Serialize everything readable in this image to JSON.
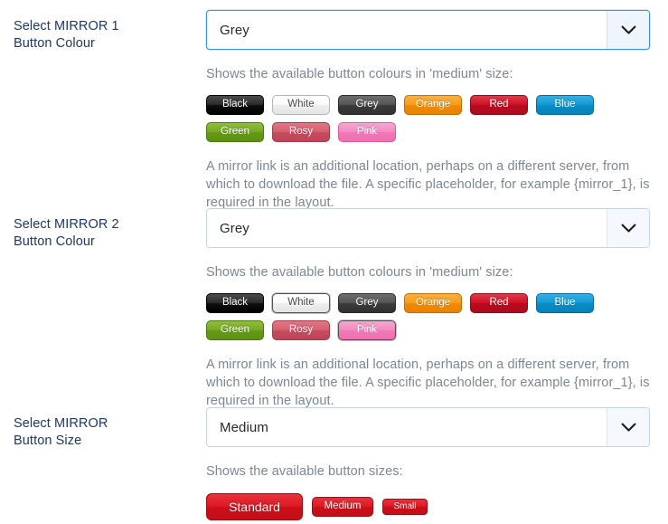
{
  "rows": [
    {
      "label_line1": "Select MIRROR 1",
      "label_line2": "Button Colour",
      "select_value": "Grey",
      "helper_top": "Shows the available button colours in 'medium' size:",
      "helper_bottom": "A mirror link is an additional location, perhaps on a different server, from which to download the file. A specific placeholder, for example {mirror_1}, is required in the layout.",
      "swatches": [
        {
          "label": "Black",
          "key": "black",
          "hex": "#000000",
          "selected": false
        },
        {
          "label": "White",
          "key": "white",
          "hex": "#eeeeee",
          "selected": false
        },
        {
          "label": "Grey",
          "key": "grey",
          "hex": "#3c3c3c",
          "selected": false
        },
        {
          "label": "Orange",
          "key": "orange",
          "hex": "#ef8b05",
          "selected": false
        },
        {
          "label": "Red",
          "key": "red",
          "hex": "#bb0a1f",
          "selected": false
        },
        {
          "label": "Blue",
          "key": "blue",
          "hex": "#0a8cc4",
          "selected": false
        },
        {
          "label": "Green",
          "key": "green",
          "hex": "#659a16",
          "selected": false
        },
        {
          "label": "Rosy",
          "key": "rosy",
          "hex": "#c74b5e",
          "selected": false
        },
        {
          "label": "Pink",
          "key": "pink",
          "hex": "#f078b6",
          "selected": false
        }
      ]
    },
    {
      "label_line1": "Select MIRROR 2",
      "label_line2": "Button Colour",
      "select_value": "Grey",
      "helper_top": "Shows the available button colours in 'medium' size:",
      "helper_bottom": "A mirror link is an additional location, perhaps on a different server, from which to download the file. A specific placeholder, for example {mirror_1}, is required in the layout.",
      "swatches": [
        {
          "label": "Black",
          "key": "black",
          "hex": "#000000",
          "selected": false
        },
        {
          "label": "White",
          "key": "white",
          "hex": "#eeeeee",
          "selected": true
        },
        {
          "label": "Grey",
          "key": "grey",
          "hex": "#3c3c3c",
          "selected": false
        },
        {
          "label": "Orange",
          "key": "orange",
          "hex": "#ef8b05",
          "selected": false
        },
        {
          "label": "Red",
          "key": "red",
          "hex": "#bb0a1f",
          "selected": false
        },
        {
          "label": "Blue",
          "key": "blue",
          "hex": "#0a8cc4",
          "selected": false
        },
        {
          "label": "Green",
          "key": "green",
          "hex": "#659a16",
          "selected": false
        },
        {
          "label": "Rosy",
          "key": "rosy",
          "hex": "#c74b5e",
          "selected": false
        },
        {
          "label": "Pink",
          "key": "pink",
          "hex": "#f078b6",
          "selected": true
        }
      ]
    }
  ],
  "size_row": {
    "label_line1": "Select MIRROR",
    "label_line2": "Button Size",
    "select_value": "Medium",
    "helper_top": "Shows the available button sizes:",
    "sizes": [
      {
        "label": "Standard",
        "key": "standard"
      },
      {
        "label": "Medium",
        "key": "medium"
      },
      {
        "label": "Small",
        "key": "small"
      }
    ],
    "size_button_hex": "#cc0d18"
  },
  "theme": {
    "label_color": "#1f3864",
    "helper_color": "#7b8794",
    "select_focus_border": "#3b8fe0",
    "select_border": "#c3d4e6",
    "select_text": "#24292e"
  },
  "icons": {
    "chevron_down": "chevron-down-icon"
  }
}
